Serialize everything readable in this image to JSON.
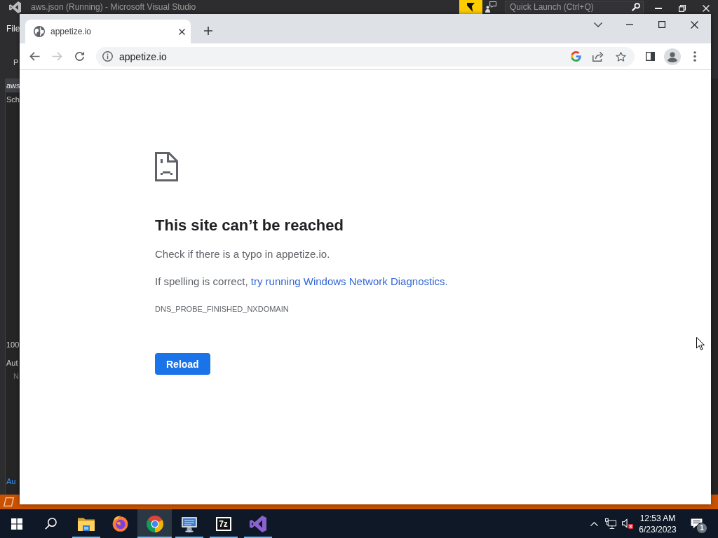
{
  "background_window": {
    "title": "aws.json (Running) - Microsoft Visual Studio",
    "quick_launch": {
      "placeholder": "Quick Launch (Ctrl+Q)"
    },
    "menu": [
      "File"
    ],
    "document_tab": "P",
    "solution_panel": {
      "tab": "aws",
      "row": "Sch"
    },
    "zoom_level": "100",
    "autos_panel": {
      "title": "Aut",
      "row": "N",
      "tabs": [
        {
          "label": "Au",
          "selected": true
        }
      ]
    }
  },
  "browser": {
    "tabs": [
      {
        "title": "appetize.io",
        "selected": true
      }
    ],
    "toolbar": {
      "back_disabled": false,
      "forward_disabled": true,
      "address": "appetize.io"
    },
    "error_page": {
      "heading": "This site can’t be reached",
      "hint": "Check if there is a typo in appetize.io.",
      "suggestion": "If spelling is correct, ",
      "suggestion_link": "try running Windows Network Diagnostics.",
      "error_code": "DNS_PROBE_FINISHED_NXDOMAIN",
      "button": "Reload"
    }
  },
  "taskbar": {
    "apps": [
      {
        "running": true,
        "selected": false
      },
      {
        "running": false,
        "selected": false
      },
      {
        "running": true,
        "selected": true
      },
      {
        "running": true,
        "selected": false
      },
      {
        "running": true,
        "selected": false,
        "label": "7z"
      },
      {
        "running": true,
        "selected": false
      }
    ],
    "tray": {
      "muted": true
    },
    "clock": {
      "time": "12:53 AM",
      "date": "6/23/2023"
    },
    "notifications": {
      "count": "1"
    }
  }
}
